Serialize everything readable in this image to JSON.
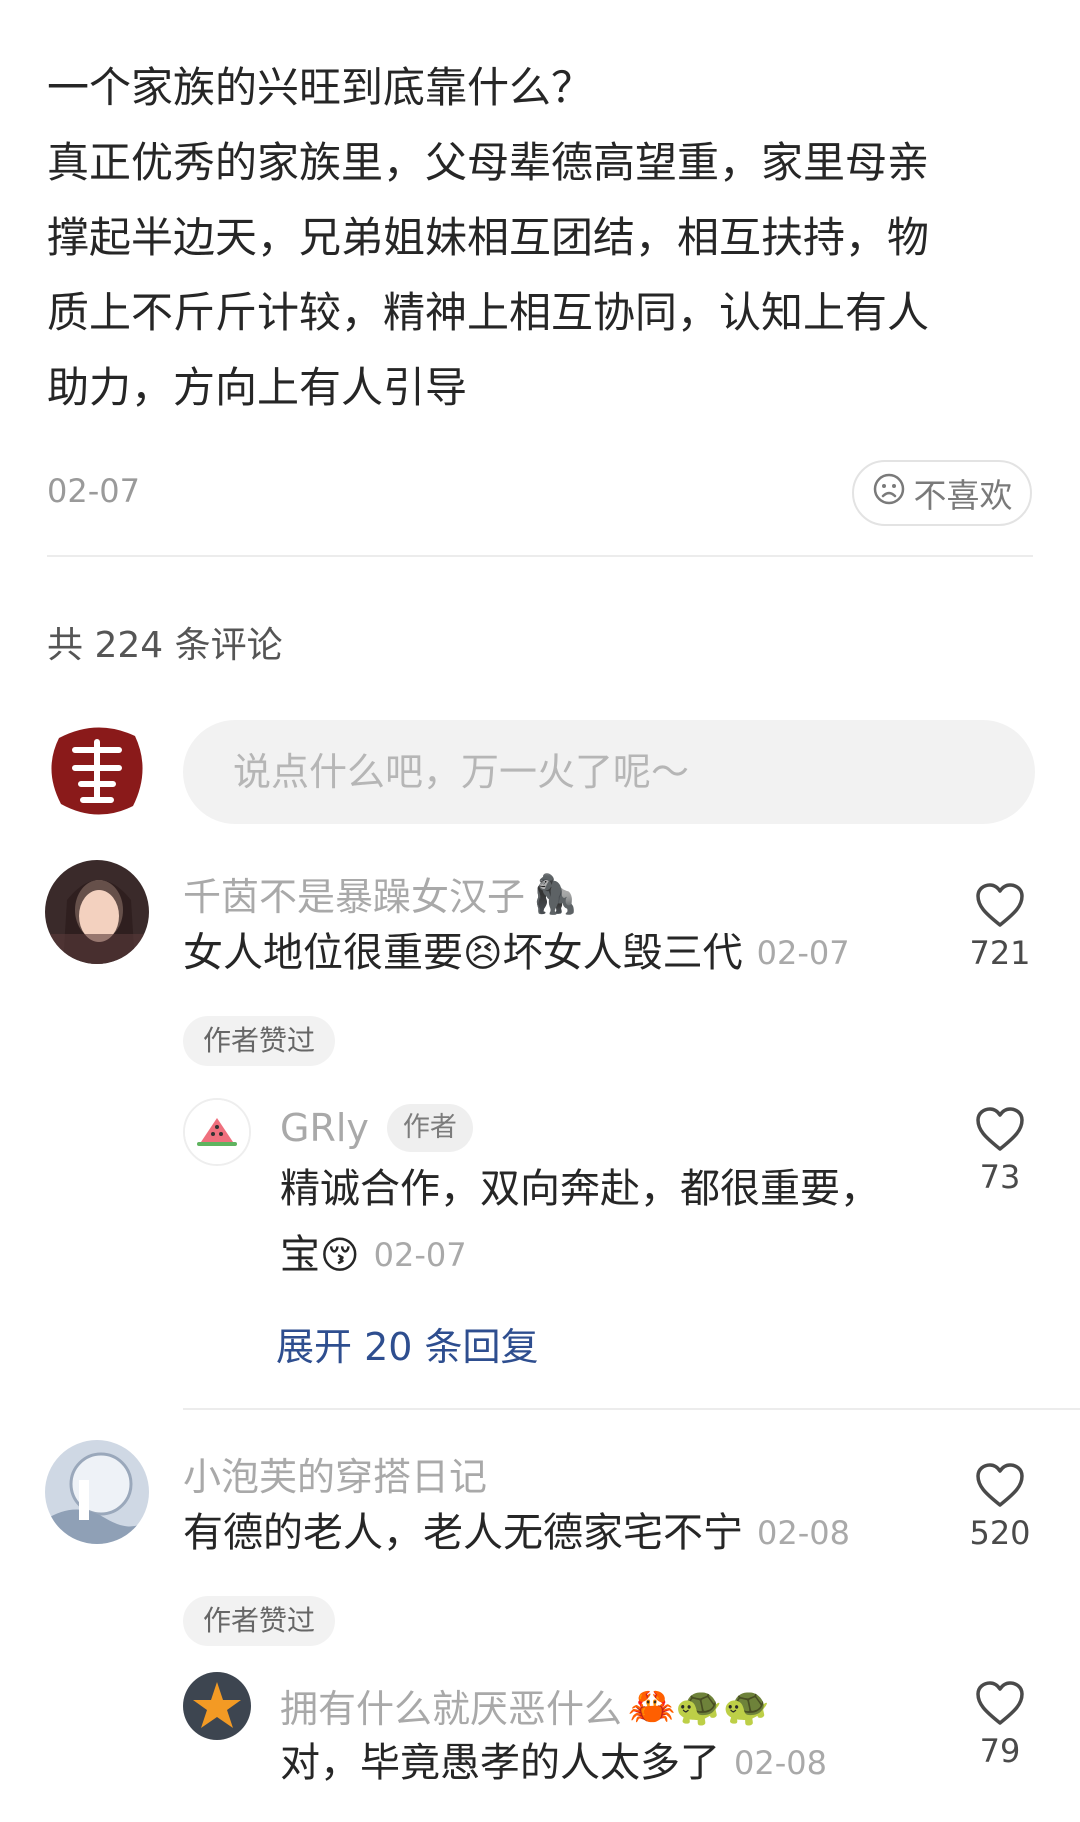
{
  "post": {
    "lines": [
      "一个家族的兴旺到底靠什么？",
      "真正优秀的家族里，父母辈德高望重，家里母亲",
      "撑起半边天，兄弟姐妹相互团结，相互扶持，物",
      "质上不斤斤计较，精神上相互协同，认知上有人",
      "助力，方向上有人引导"
    ],
    "date": "02-07",
    "dislike_label": "不喜欢"
  },
  "comments_header": "共 224 条评论",
  "input": {
    "placeholder": "说点什么吧，万一火了呢～"
  },
  "comments": [
    {
      "user": "千茵不是暴躁女汉子",
      "user_emoji": "🦍",
      "text_a": "女人地位很重要",
      "emoji_mid": "😣",
      "text_b": "坏女人毁三代",
      "time": "02-07",
      "likes": "721",
      "badge": "作者赞过",
      "reply": {
        "user": "GRly",
        "author_tag": "作者",
        "line1": "精诚合作，双向奔赴，都很重要，",
        "line2": "宝",
        "emoji": "😚",
        "time": "02-07",
        "likes": "73"
      },
      "expand_label": "展开 20 条回复"
    },
    {
      "user": "小泡芙的穿搭日记",
      "text": "有德的老人，老人无德家宅不宁",
      "time": "02-08",
      "likes": "520",
      "badge": "作者赞过",
      "reply": {
        "user": "拥有什么就厌恶什么",
        "user_emojis": "🦀🐢🐢",
        "text": "对，毕竟愚孝的人太多了",
        "time": "02-08",
        "likes": "79"
      }
    }
  ],
  "colors": {
    "expand_link": "#2e4e8f",
    "seal": "#8a1a1a"
  },
  "icons": [
    "seal-avatar",
    "heart-icon",
    "frown-icon",
    "watermelon-icon",
    "starfish-icon"
  ]
}
